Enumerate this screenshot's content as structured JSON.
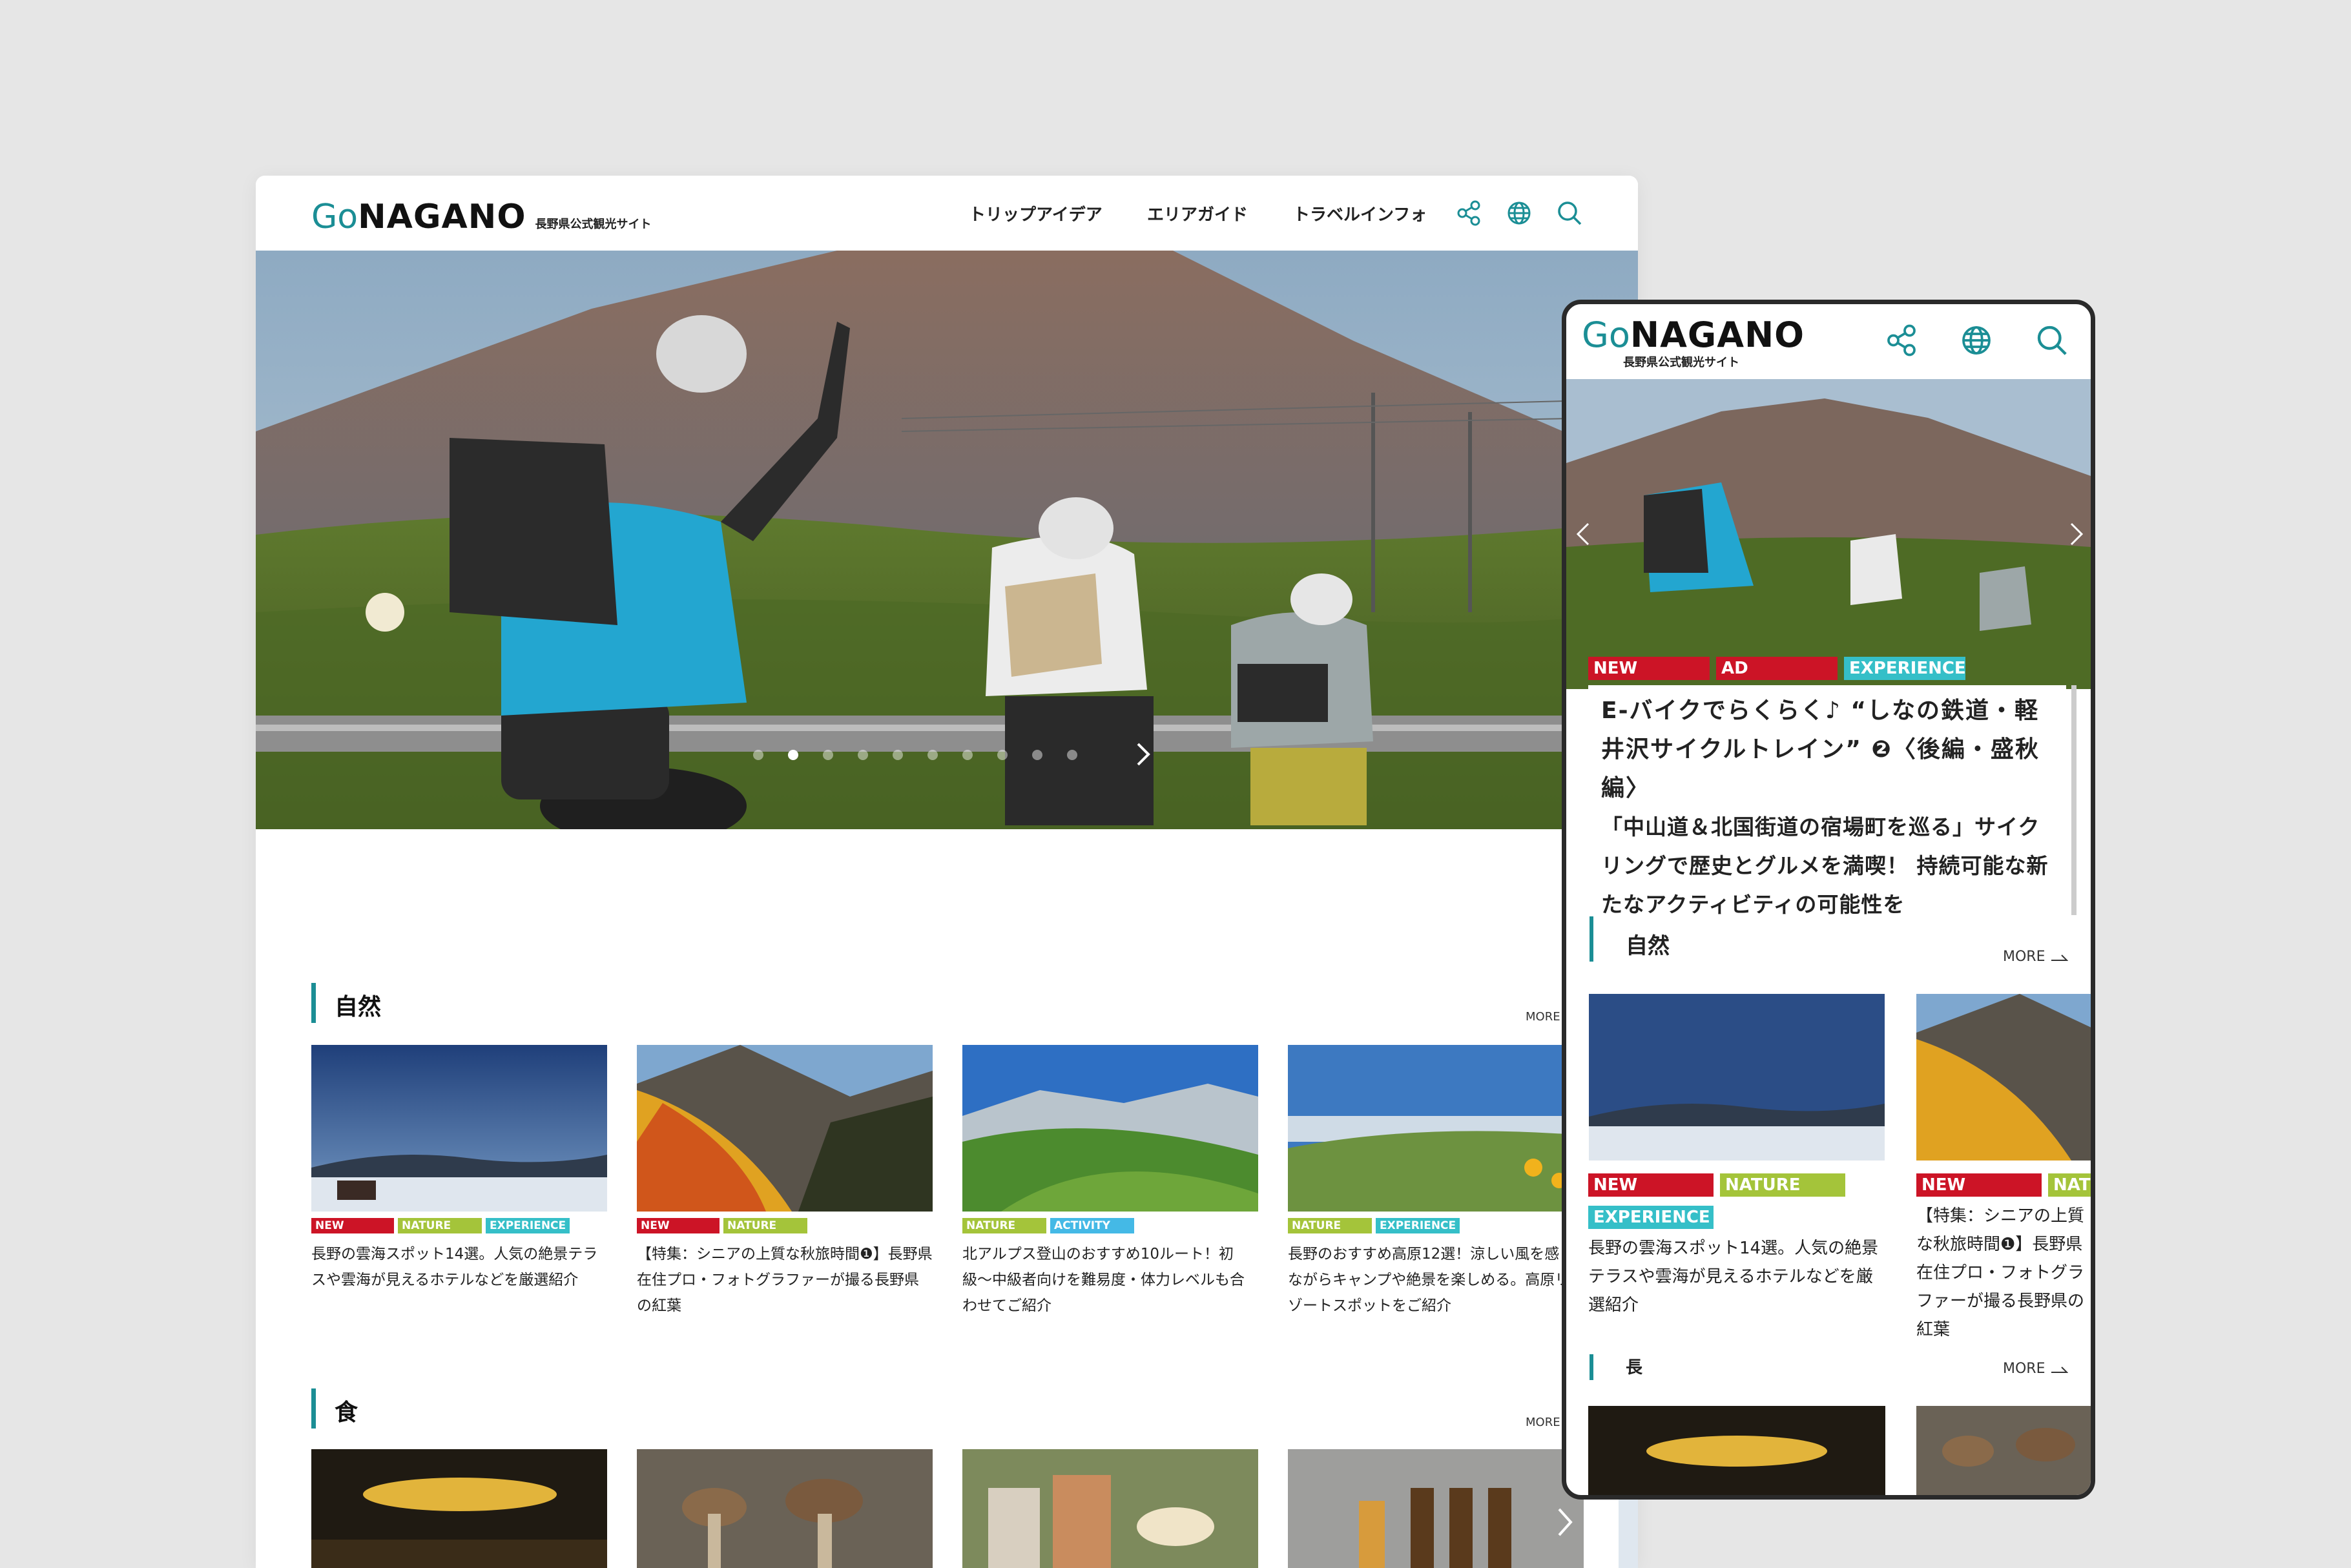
{
  "brand": {
    "logo_go": "Go",
    "logo_nagano": "NAGANO",
    "tagline": "長野県公式観光サイト",
    "accent": "#1b8e95"
  },
  "desktop": {
    "nav": [
      "トリップアイデア",
      "エリアガイド",
      "トラベルインフォ"
    ],
    "icons": [
      "share-icon",
      "globe-icon",
      "search-icon"
    ],
    "carousel": {
      "dot_count": 10,
      "active_index": 1
    },
    "sections": [
      {
        "title": "自然",
        "more": "MORE",
        "cards": [
          {
            "tags": [
              "NEW",
              "NATURE",
              "EXPERIENCE"
            ],
            "text": "長野の雲海スポット14選。人気の絶景テラスや雲海が見えるホテルなどを厳選紹介"
          },
          {
            "tags": [
              "NEW",
              "NATURE"
            ],
            "text": "【特集：シニアの上質な秋旅時間❶】長野県在住プロ・フォトグラファーが撮る長野県の紅葉"
          },
          {
            "tags": [
              "NATURE",
              "ACTIVITY"
            ],
            "text": "北アルプス登山のおすすめ10ルート！初級〜中級者向けを難易度・体力レベルも合わせてご紹介"
          },
          {
            "tags": [
              "NATURE",
              "EXPERIENCE"
            ],
            "text": "長野のおすすめ高原12選！涼しい風を感じながらキャンプや絶景を楽しめる。高原リゾートスポットをご紹介"
          }
        ]
      },
      {
        "title": "食",
        "more": "MORE"
      }
    ]
  },
  "mobile": {
    "hero_tags": [
      "NEW",
      "AD",
      "EXPERIENCE"
    ],
    "hero_title": "E-バイクでらくらく♪ “しなの鉄道・軽井沢サイクルトレイン” ❷〈後編・盛秋編〉",
    "hero_desc": "「中山道＆北国街道の宿場町を巡る」サイクリングで歴史とグルメを満喫！ 持続可能な新たなアクティビティの可能性を",
    "sections": [
      {
        "title": "自然",
        "more": "MORE",
        "cards": [
          {
            "tags": [
              "NEW",
              "NATURE",
              "EXPERIENCE"
            ],
            "text": "長野の雲海スポット14選。人気の絶景テラスや雲海が見えるホテルなどを厳選紹介"
          },
          {
            "tags": [
              "NEW",
              "NAT"
            ],
            "text": "【特集：シニアの上質な秋旅時間❶】長野県在住プロ・フォトグラファーが撮る長野県の紅葉"
          }
        ]
      },
      {
        "title": "長",
        "more": "MORE"
      }
    ]
  },
  "colors": {
    "new": "#cc1426",
    "nature": "#a4c43a",
    "experience": "#35bfc8",
    "activity": "#44b9e6",
    "ad": "#cc1426"
  }
}
